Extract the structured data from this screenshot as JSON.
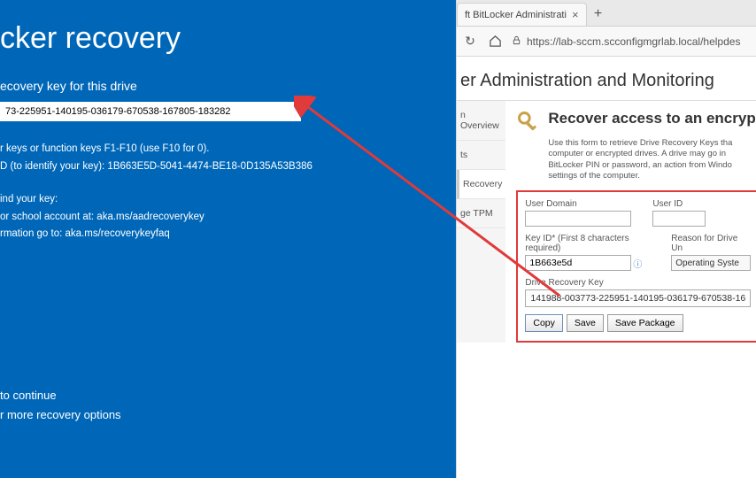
{
  "recovery": {
    "title": "cker recovery",
    "subtitle": "ecovery key for this drive",
    "key_value": "73-225951-140195-036179-670538-167805-183282",
    "hint_line1": "r keys or function keys F1-F10 (use F10 for 0).",
    "hint_line2": "D (to identify your key): 1B663E5D-5041-4474-BE18-0D135A53B386",
    "find_title": "ind your key:",
    "find_line1": "or school account at: aka.ms/aadrecoverykey",
    "find_line2": "rmation go to: aka.ms/recoverykeyfaq",
    "bottom1": "to continue",
    "bottom2": "r more recovery options"
  },
  "browser": {
    "tab_title": "ft BitLocker Administrati",
    "url": "https://lab-sccm.scconfigmgrlab.local/helpdes"
  },
  "page": {
    "header": "er Administration and Monitoring",
    "panel_title": "Recover access to an encryp",
    "panel_desc1": "Use this form to retrieve Drive Recovery Keys tha",
    "panel_desc2": "computer or encrypted drives. A drive may go in",
    "panel_desc3": "BitLocker PIN or password, an action from Windo",
    "panel_desc4": "settings of the computer.",
    "nav": {
      "overview": "n Overview",
      "reports": "ts",
      "recovery": "Recovery",
      "tpm": "ge TPM"
    },
    "form": {
      "user_domain_label": "User Domain",
      "user_id_label": "User ID",
      "key_id_label": "Key ID* (First 8 characters required)",
      "key_id_value": "1B663e5d",
      "reason_label": "Reason for Drive Un",
      "reason_placeholder": "Operating Syste",
      "output_label": "Drive Recovery Key",
      "output_value": "141988-003773-225951-140195-036179-670538-16",
      "btn_copy": "Copy",
      "btn_save": "Save",
      "btn_savepkg": "Save Package"
    }
  }
}
